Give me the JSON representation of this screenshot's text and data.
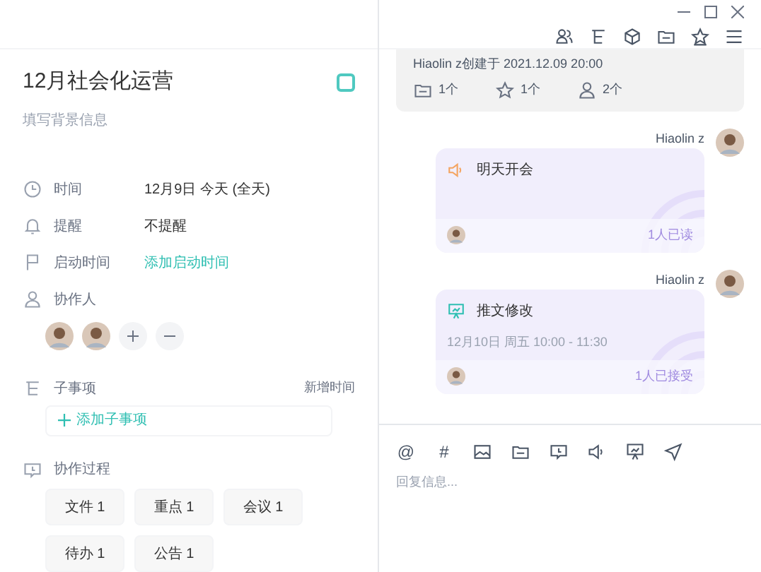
{
  "task": {
    "title": "12月社会化运营",
    "done": false,
    "description_placeholder": "填写背景信息"
  },
  "fields": [
    {
      "kind": "time",
      "label": "时间",
      "value": "12月9日 今天 (全天)",
      "link": false
    },
    {
      "kind": "bell",
      "label": "提醒",
      "value": "不提醒",
      "link": false
    },
    {
      "kind": "flag",
      "label": "启动时间",
      "value": "添加启动时间",
      "link": true
    }
  ],
  "collaborators": {
    "label": "协作人",
    "members": [
      {
        "kind": "photo"
      },
      {
        "kind": "photo"
      }
    ]
  },
  "subtasks": {
    "label": "子事项",
    "action": "新增时间",
    "add": "添加子事项"
  },
  "process": {
    "label": "协作过程",
    "chips": [
      "文件 1",
      "重点 1",
      "会议 1",
      "待办 1",
      "公告 1"
    ]
  },
  "top_card": {
    "meta": "Hiaolin z创建于 2021.12.09 20:00",
    "stats": [
      {
        "kind": "folder",
        "text": "1个"
      },
      {
        "kind": "star",
        "text": "1个"
      },
      {
        "kind": "person",
        "text": "2个"
      }
    ]
  },
  "messages": [
    {
      "kind": "announce",
      "sender": "Hiaolin z",
      "title": "明天开会",
      "status": "1人已读"
    },
    {
      "kind": "meeting",
      "sender": "Hiaolin z",
      "title": "推文修改",
      "detail": "12月10日 周五 10:00 - 11:30",
      "status": "1人已接受"
    }
  ],
  "composer": {
    "symbols": [
      "@",
      "#"
    ],
    "placeholder": "回复信息..."
  }
}
